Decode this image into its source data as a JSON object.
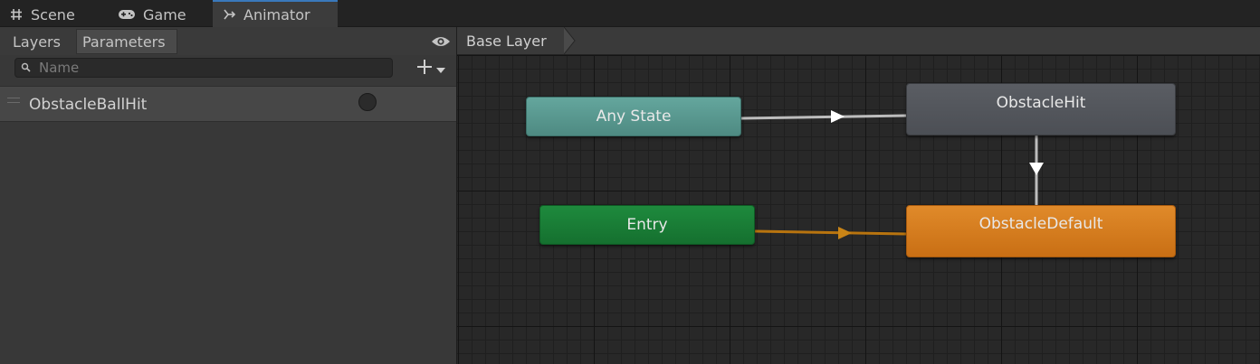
{
  "tabs": [
    {
      "label": "Scene",
      "icon": "hash-icon"
    },
    {
      "label": "Game",
      "icon": "gamepad-icon"
    },
    {
      "label": "Animator",
      "icon": "animator-icon",
      "active": true
    }
  ],
  "left_panel": {
    "tabs": [
      {
        "label": "Layers"
      },
      {
        "label": "Parameters",
        "active": true
      }
    ],
    "search": {
      "placeholder": "Name",
      "value": ""
    },
    "parameters": [
      {
        "name": "ObstacleBallHit",
        "type": "trigger"
      }
    ]
  },
  "graph": {
    "breadcrumb": "Base Layer",
    "nodes": {
      "any_state": {
        "label": "Any State",
        "color": "#5a9a91"
      },
      "entry": {
        "label": "Entry",
        "color": "#1a7d36"
      },
      "obstacle_hit": {
        "label": "ObstacleHit",
        "color": "#53565c"
      },
      "obstacle_default": {
        "label": "ObstacleDefault",
        "color": "#d67c1e"
      }
    },
    "transition_colors": {
      "normal": "#bdbdbd",
      "entry": "#b8740f"
    }
  }
}
